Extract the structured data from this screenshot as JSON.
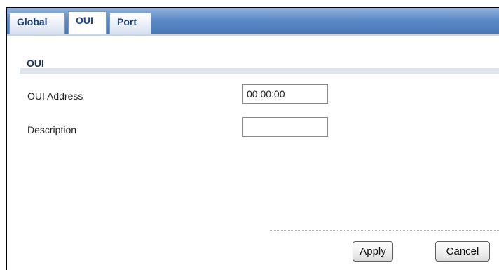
{
  "tabs": [
    {
      "label": "Global",
      "active": false
    },
    {
      "label": "OUI",
      "active": true
    },
    {
      "label": "Port",
      "active": false
    }
  ],
  "section": {
    "title": "OUI"
  },
  "fields": {
    "oui_address": {
      "label": "OUI Address",
      "value": "00:00:00"
    },
    "description": {
      "label": "Description",
      "value": ""
    }
  },
  "buttons": {
    "apply": "Apply",
    "cancel": "Cancel"
  },
  "colors": {
    "tabbar": "#5d8ac6",
    "tab_text": "#1a3f7a",
    "section_rule": "#dde5ef"
  }
}
